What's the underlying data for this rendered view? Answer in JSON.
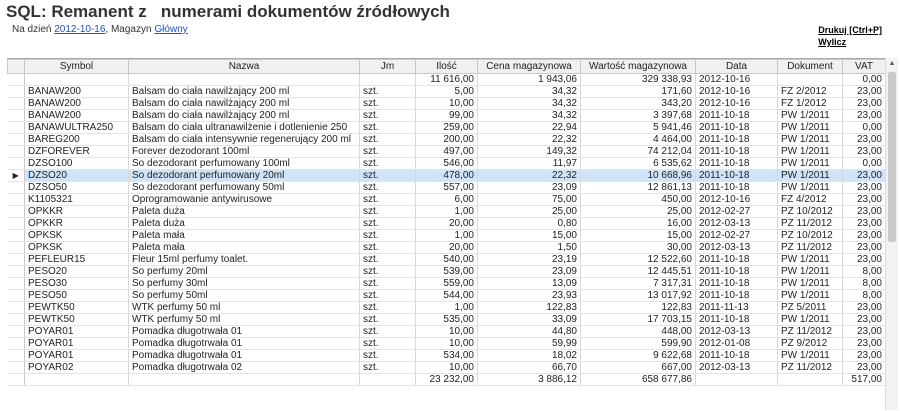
{
  "header": {
    "title": "SQL: Remanent z   numerami dokumentów źródłowych",
    "date_prefix": "Na dzień ",
    "date_link": "2012-10-16",
    "store_prefix": ", Magazyn ",
    "store_link": "Główny"
  },
  "actions": {
    "print": "Drukuj [Ctrl+P]",
    "calc": "Wylicz"
  },
  "table": {
    "columns": [
      "Symbol",
      "Nazwa",
      "Jm",
      "Ilość",
      "Cena magazynowa",
      "Wartość magazynowa",
      "Data",
      "Dokument",
      "VAT"
    ],
    "summary": [
      "",
      "",
      "",
      "11 616,00",
      "1 943,06",
      "329 338,93",
      "2012-10-16",
      "",
      "0,00"
    ],
    "selected_index": 7,
    "selected_marker": "▶",
    "rows": [
      [
        "BANAW200",
        "Balsam do ciała nawilżający 200 ml",
        "szt.",
        "5,00",
        "34,32",
        "171,60",
        "2012-10-16",
        "FZ 2/2012",
        "23,00"
      ],
      [
        "BANAW200",
        "Balsam do ciała nawilżający 200 ml",
        "szt.",
        "10,00",
        "34,32",
        "343,20",
        "2012-10-16",
        "FZ 1/2012",
        "23,00"
      ],
      [
        "BANAW200",
        "Balsam do ciała nawilżający 200 ml",
        "szt.",
        "99,00",
        "34,32",
        "3 397,68",
        "2011-10-18",
        "PW 1/2011",
        "23,00"
      ],
      [
        "BANAWULTRA250",
        "Balsam do ciała ultranawilżenie i dotlenienie 250",
        "szt.",
        "259,00",
        "22,94",
        "5 941,46",
        "2011-10-18",
        "PW 1/2011",
        "0,00"
      ],
      [
        "BAREG200",
        "Balsam do ciała intensywnie regenerujący 200 ml",
        "szt.",
        "200,00",
        "22,32",
        "4 464,00",
        "2011-10-18",
        "PW 1/2011",
        "23,00"
      ],
      [
        "DZFOREVER",
        "Forever dezodorant 100ml",
        "szt.",
        "497,00",
        "149,32",
        "74 212,04",
        "2011-10-18",
        "PW 1/2011",
        "23,00"
      ],
      [
        "DZSO100",
        "So dezodorant perfumowany 100ml",
        "szt.",
        "546,00",
        "11,97",
        "6 535,62",
        "2011-10-18",
        "PW 1/2011",
        "0,00"
      ],
      [
        "DZSO20",
        "So dezodorant perfumowany 20ml",
        "szt.",
        "478,00",
        "22,32",
        "10 668,96",
        "2011-10-18",
        "PW 1/2011",
        "23,00"
      ],
      [
        "DZSO50",
        "So dezodorant perfumowany 50ml",
        "szt.",
        "557,00",
        "23,09",
        "12 861,13",
        "2011-10-18",
        "PW 1/2011",
        "23,00"
      ],
      [
        "K1105321",
        "Oprogramowanie antywirusowe",
        "szt.",
        "6,00",
        "75,00",
        "450,00",
        "2012-10-16",
        "FZ 4/2012",
        "23,00"
      ],
      [
        "OPKKR",
        "Paleta duża",
        "szt.",
        "1,00",
        "25,00",
        "25,00",
        "2012-02-27",
        "PZ 10/2012",
        "23,00"
      ],
      [
        "OPKKR",
        "Paleta duża",
        "szt.",
        "20,00",
        "0,80",
        "16,00",
        "2012-03-13",
        "PZ 11/2012",
        "23,00"
      ],
      [
        "OPKSK",
        "Paleta mała",
        "szt.",
        "1,00",
        "15,00",
        "15,00",
        "2012-02-27",
        "PZ 10/2012",
        "23,00"
      ],
      [
        "OPKSK",
        "Paleta mała",
        "szt.",
        "20,00",
        "1,50",
        "30,00",
        "2012-03-13",
        "PZ 11/2012",
        "23,00"
      ],
      [
        "PEFLEUR15",
        "Fleur 15ml perfumy toalet.",
        "szt.",
        "540,00",
        "23,19",
        "12 522,60",
        "2011-10-18",
        "PW 1/2011",
        "23,00"
      ],
      [
        "PESO20",
        "So perfumy 20ml",
        "szt.",
        "539,00",
        "23,09",
        "12 445,51",
        "2011-10-18",
        "PW 1/2011",
        "8,00"
      ],
      [
        "PESO30",
        "So perfumy 30ml",
        "szt.",
        "559,00",
        "13,09",
        "7 317,31",
        "2011-10-18",
        "PW 1/2011",
        "8,00"
      ],
      [
        "PESO50",
        "So perfumy 50ml",
        "szt.",
        "544,00",
        "23,93",
        "13 017,92",
        "2011-10-18",
        "PW 1/2011",
        "8,00"
      ],
      [
        "PEWTK50",
        "WTK perfumy 50 ml",
        "szt.",
        "1,00",
        "122,83",
        "122,83",
        "2011-11-13",
        "PZ 5/2011",
        "23,00"
      ],
      [
        "PEWTK50",
        "WTK perfumy 50 ml",
        "szt.",
        "535,00",
        "33,09",
        "17 703,15",
        "2011-10-18",
        "PW 1/2011",
        "23,00"
      ],
      [
        "POYAR01",
        "Pomadka długotrwała 01",
        "szt.",
        "10,00",
        "44,80",
        "448,00",
        "2012-03-13",
        "PZ 11/2012",
        "23,00"
      ],
      [
        "POYAR01",
        "Pomadka długotrwała 01",
        "szt.",
        "10,00",
        "59,99",
        "599,90",
        "2012-01-08",
        "PZ 9/2012",
        "23,00"
      ],
      [
        "POYAR01",
        "Pomadka długotrwała 01",
        "szt.",
        "534,00",
        "18,02",
        "9 622,68",
        "2011-10-18",
        "PW 1/2011",
        "23,00"
      ],
      [
        "POYAR02",
        "Pomadka długotrwała 02",
        "szt.",
        "10,00",
        "66,70",
        "667,00",
        "2012-03-13",
        "PZ 11/2012",
        "23,00"
      ]
    ],
    "totals": [
      "",
      "",
      "",
      "23 232,00",
      "3 886,12",
      "658 677,86",
      "",
      "",
      "517,00"
    ]
  }
}
